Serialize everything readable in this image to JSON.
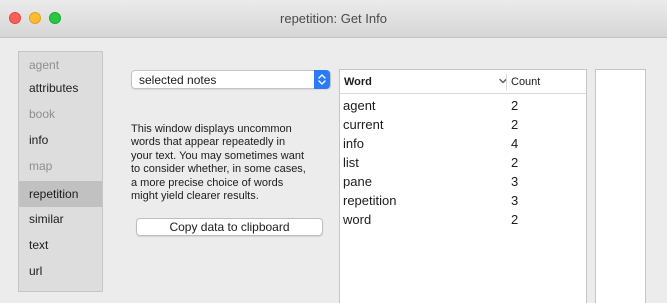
{
  "window": {
    "title": "repetition: Get Info"
  },
  "sidebar": {
    "items": [
      {
        "label": "agent"
      },
      {
        "label": "attributes"
      },
      {
        "label": "book"
      },
      {
        "label": "info"
      },
      {
        "label": "map"
      },
      {
        "label": "repetition",
        "selected": true
      },
      {
        "label": "similar"
      },
      {
        "label": "text"
      },
      {
        "label": "url"
      }
    ]
  },
  "dropdown": {
    "selected": "selected notes"
  },
  "description": {
    "lines": [
      "This window displays uncommon",
      "words that appear repeatedly  in",
      "your text. You may sometimes want",
      "to consider whether, in some cases,",
      "a more precise choice of words",
      "might yield clearer results."
    ]
  },
  "copy_button": {
    "label": "Copy data to clipboard"
  },
  "table": {
    "columns": {
      "word": "Word",
      "count": "Count"
    },
    "rows": [
      {
        "word": "agent",
        "count": "2"
      },
      {
        "word": "current",
        "count": "2"
      },
      {
        "word": "info",
        "count": "4"
      },
      {
        "word": "list",
        "count": "2"
      },
      {
        "word": "pane",
        "count": "3"
      },
      {
        "word": "repetition",
        "count": "3"
      },
      {
        "word": "word",
        "count": "2"
      }
    ]
  },
  "colors": {
    "accent": "#2a7cf6",
    "selected_item": "#c1c1c1",
    "close": "#fe5f57",
    "minimize": "#febc2e",
    "zoom": "#28c840"
  },
  "icons": {
    "close": "close-icon",
    "minimize": "minimize-icon",
    "zoom": "zoom-icon",
    "popup_stepper": "chevron-up-down-icon",
    "sort": "chevron-down-icon"
  }
}
